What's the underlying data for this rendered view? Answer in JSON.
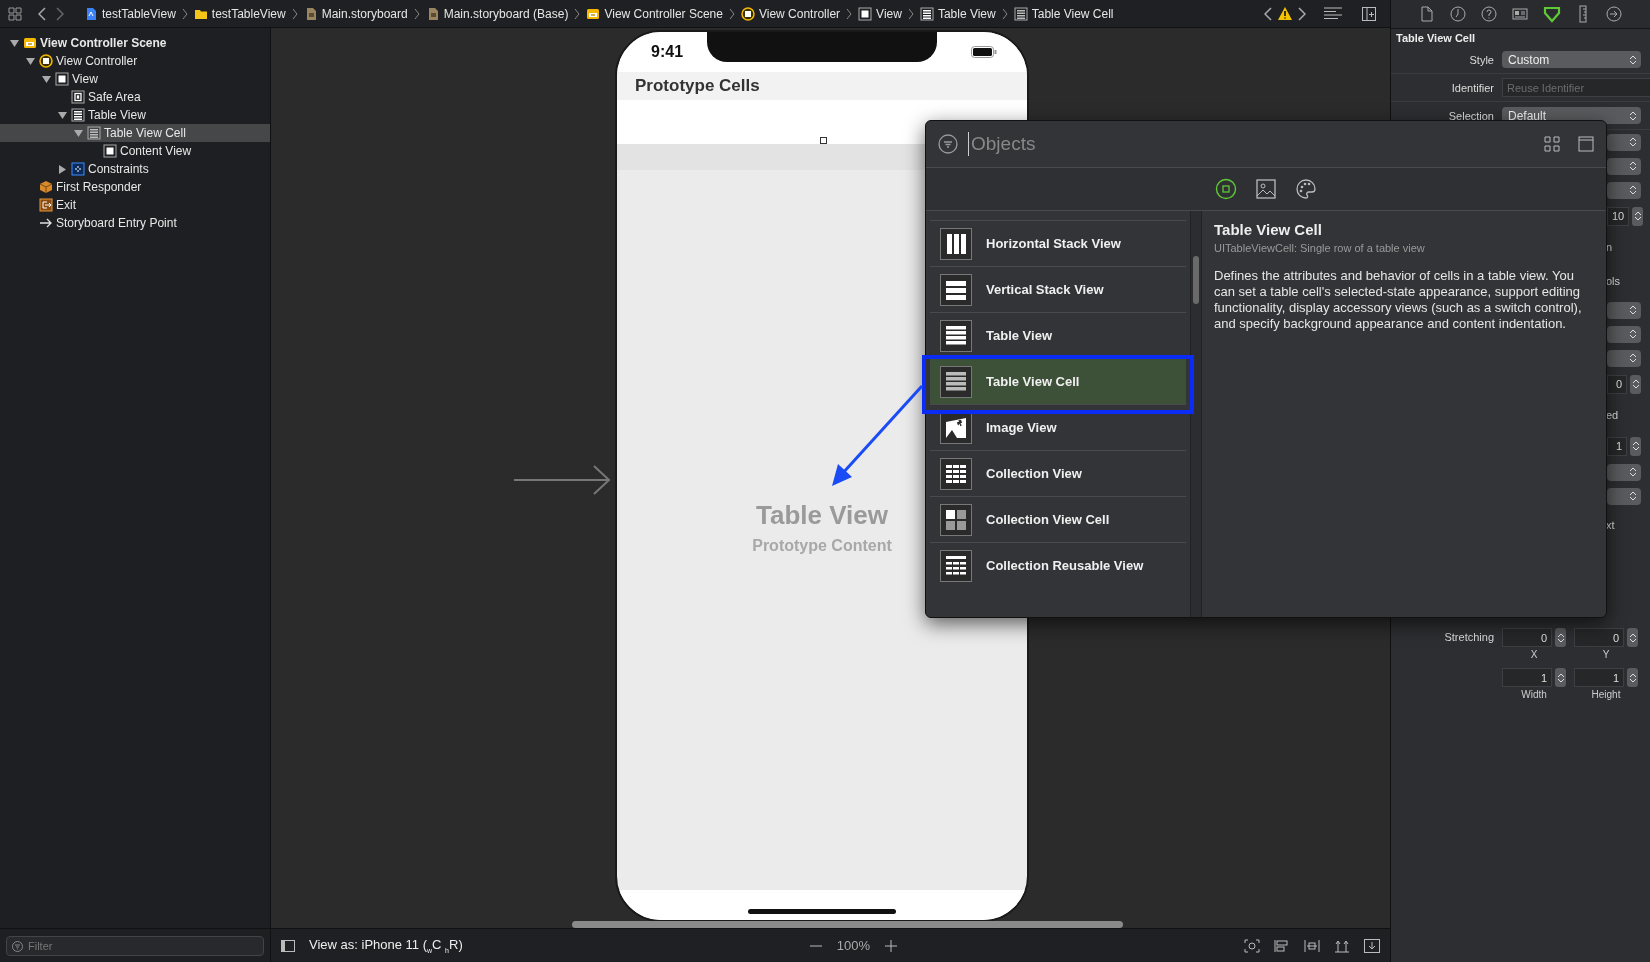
{
  "toolbar": {
    "breadcrumbs": [
      {
        "label": "testTableView",
        "kind": "project"
      },
      {
        "label": "testTableView",
        "kind": "folder"
      },
      {
        "label": "Main.storyboard",
        "kind": "storyboard"
      },
      {
        "label": "Main.storyboard (Base)",
        "kind": "storyboard"
      },
      {
        "label": "View Controller Scene",
        "kind": "scene"
      },
      {
        "label": "View Controller",
        "kind": "controller"
      },
      {
        "label": "View",
        "kind": "view"
      },
      {
        "label": "Table View",
        "kind": "table"
      },
      {
        "label": "Table View Cell",
        "kind": "cell"
      }
    ]
  },
  "inspector_tabs": [
    {
      "kind": "file",
      "selected": false
    },
    {
      "kind": "history",
      "selected": false
    },
    {
      "kind": "help",
      "selected": false
    },
    {
      "kind": "identity",
      "selected": false
    },
    {
      "kind": "attributes",
      "selected": true
    },
    {
      "kind": "size",
      "selected": false
    },
    {
      "kind": "connections",
      "selected": false
    }
  ],
  "outline": [
    {
      "label": "View Controller Scene",
      "kind": "scene",
      "expanded": true,
      "selected": false,
      "children": [
        {
          "label": "View Controller",
          "kind": "controller",
          "expanded": true,
          "selected": false,
          "children": [
            {
              "label": "View",
              "kind": "view",
              "expanded": true,
              "selected": false,
              "children": [
                {
                  "label": "Safe Area",
                  "kind": "safe",
                  "selected": false
                },
                {
                  "label": "Table View",
                  "kind": "table",
                  "expanded": true,
                  "selected": false,
                  "children": [
                    {
                      "label": "Table View Cell",
                      "kind": "cell",
                      "expanded": true,
                      "selected": true,
                      "children": [
                        {
                          "label": "Content View",
                          "kind": "view",
                          "selected": false
                        }
                      ]
                    }
                  ]
                },
                {
                  "label": "Constraints",
                  "kind": "constraints",
                  "expanded": false,
                  "selected": false
                }
              ]
            }
          ]
        },
        {
          "label": "First Responder",
          "kind": "responder",
          "selected": false
        },
        {
          "label": "Exit",
          "kind": "exit",
          "selected": false
        },
        {
          "label": "Storyboard Entry Point",
          "kind": "entry",
          "selected": false
        }
      ]
    }
  ],
  "outline_filter": {
    "placeholder": "Filter"
  },
  "phone": {
    "time": "9:41",
    "nav_title": "Prototype Cells",
    "table_title": "Table View",
    "table_subtitle": "Prototype Content"
  },
  "library": {
    "search": {
      "placeholder": "Objects"
    },
    "tabs": [
      {
        "kind": "objects",
        "selected": true
      },
      {
        "kind": "media",
        "selected": false
      },
      {
        "kind": "colors",
        "selected": false
      }
    ],
    "items": [
      {
        "label": "Horizontal Stack View",
        "kind": "hstack",
        "selected": false
      },
      {
        "label": "Vertical Stack View",
        "kind": "vstack",
        "selected": false
      },
      {
        "label": "Table View",
        "kind": "table",
        "selected": false
      },
      {
        "label": "Table View Cell",
        "kind": "cell",
        "selected": true
      },
      {
        "label": "Image View",
        "kind": "image",
        "selected": false
      },
      {
        "label": "Collection View",
        "kind": "collection",
        "selected": false
      },
      {
        "label": "Collection View Cell",
        "kind": "collection_cell",
        "selected": false
      },
      {
        "label": "Collection Reusable View",
        "kind": "reusable",
        "selected": false
      }
    ],
    "detail": {
      "title": "Table View Cell",
      "subtitle": "UITableViewCell: Single row of a table view",
      "description": "Defines the attributes and behavior of cells in a table view. You can set a table cell's selected-state appearance, support editing functionality, display accessory views (such as a switch control), and specify background appearance and content indentation."
    }
  },
  "inspector": {
    "title": "Table View Cell",
    "rows": [
      {
        "kind": "popup",
        "label": "Style",
        "value": "Custom"
      },
      {
        "kind": "text_field",
        "label": "Identifier",
        "placeholder": "Reuse Identifier"
      },
      {
        "kind": "popup",
        "label": "Selection",
        "value": "Default"
      },
      {
        "kind": "popup"
      },
      {
        "kind": "popup"
      },
      {
        "kind": "popup"
      },
      {
        "kind": "stepper",
        "value": "10"
      },
      {
        "kind": "fragment",
        "text": "n"
      },
      {
        "kind": "fragment",
        "text": "ols"
      },
      {
        "kind": "popup"
      },
      {
        "kind": "popup"
      },
      {
        "kind": "popup"
      },
      {
        "kind": "stepper",
        "value": "0"
      },
      {
        "kind": "fragment",
        "text": "ed"
      },
      {
        "kind": "stepper",
        "value": "1"
      },
      {
        "kind": "popup"
      },
      {
        "kind": "popup"
      },
      {
        "kind": "fragment",
        "text": "xt"
      },
      {
        "kind": "pair",
        "label": "Stretching",
        "fields": [
          {
            "value": "0",
            "caption": "X"
          },
          {
            "value": "0",
            "caption": "Y"
          }
        ]
      },
      {
        "kind": "pair",
        "fields": [
          {
            "value": "1",
            "caption": "Width"
          },
          {
            "value": "1",
            "caption": "Height"
          }
        ]
      }
    ]
  },
  "bottom_bar": {
    "device": "View as: iPhone 11 ($_{w}$C $_{h}$R)",
    "zoom": "100%"
  }
}
